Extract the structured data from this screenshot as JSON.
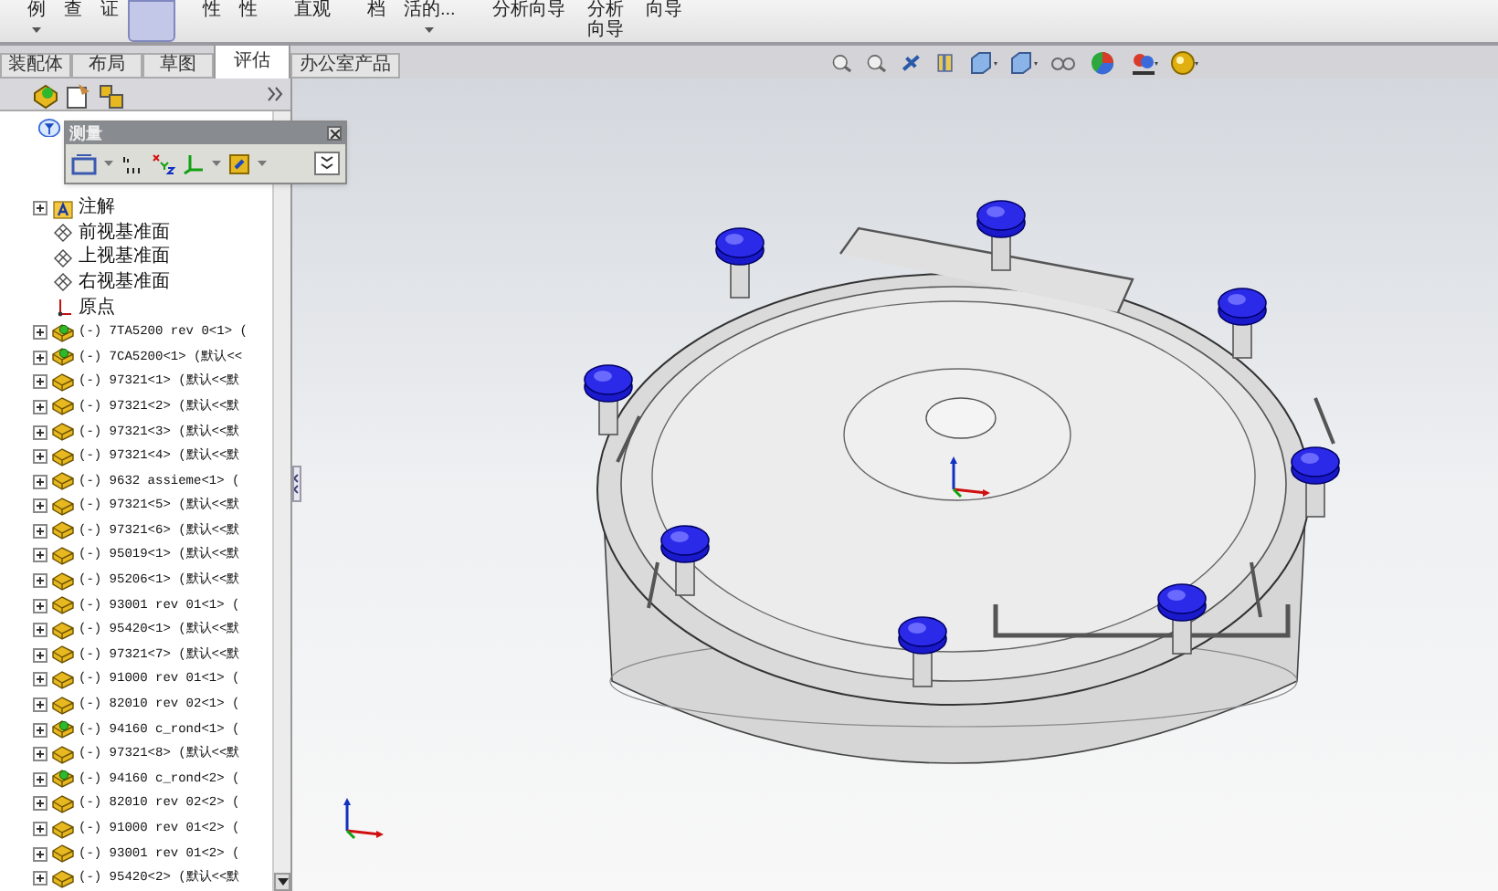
{
  "ribbon": [
    {
      "label": "例",
      "selected": false,
      "dropdown": true
    },
    {
      "label": "查",
      "selected": false,
      "dropdown": false
    },
    {
      "label": "证",
      "selected": false,
      "dropdown": false
    },
    {
      "selected": true,
      "dropdown": false
    },
    {
      "label": "性",
      "selected": false,
      "dropdown": false
    },
    {
      "label": "性",
      "selected": false,
      "dropdown": false
    },
    {
      "label": "直观",
      "selected": false,
      "dropdown": false
    },
    {
      "label": "档",
      "selected": false,
      "dropdown": false
    },
    {
      "label": "活的...",
      "selected": false,
      "dropdown": true
    },
    {
      "label": "分析向导",
      "selected": false,
      "dropdown": false
    },
    {
      "label": "分析向导",
      "selected": false,
      "dropdown": false
    },
    {
      "label": "向导",
      "selected": false,
      "dropdown": false
    }
  ],
  "tabs": [
    {
      "label": "装配体",
      "selected": false
    },
    {
      "label": "布局",
      "selected": false
    },
    {
      "label": "草图",
      "selected": false
    },
    {
      "label": "评估",
      "selected": true
    },
    {
      "label": "办公室产品",
      "selected": false
    }
  ],
  "measure": {
    "title": "测量"
  },
  "tree": {
    "features": [
      {
        "label": "注解",
        "kind": "annotation"
      },
      {
        "label": "前视基准面",
        "kind": "plane"
      },
      {
        "label": "上视基准面",
        "kind": "plane"
      },
      {
        "label": "右视基准面",
        "kind": "plane"
      },
      {
        "label": "原点",
        "kind": "origin"
      }
    ],
    "components": [
      {
        "label": "(-) 7TA5200 rev 0<1> (",
        "kind": "subassembly",
        "expanded": false
      },
      {
        "label": "(-) 7CA5200<1> (默认<<",
        "kind": "subassembly",
        "expanded": false
      },
      {
        "label": "(-) 97321<1> (默认<<默",
        "kind": "part",
        "expanded": false
      },
      {
        "label": "(-) 97321<2> (默认<<默",
        "kind": "part",
        "expanded": false
      },
      {
        "label": "(-) 97321<3> (默认<<默",
        "kind": "part",
        "expanded": false
      },
      {
        "label": "(-) 97321<4> (默认<<默",
        "kind": "part",
        "expanded": false
      },
      {
        "label": "(-) 9632 assieme<1> (",
        "kind": "part",
        "expanded": false
      },
      {
        "label": "(-) 97321<5> (默认<<默",
        "kind": "part",
        "expanded": false
      },
      {
        "label": "(-) 97321<6> (默认<<默",
        "kind": "part",
        "expanded": false
      },
      {
        "label": "(-) 95019<1> (默认<<默",
        "kind": "part",
        "expanded": false
      },
      {
        "label": "(-) 95206<1> (默认<<默",
        "kind": "part",
        "expanded": false
      },
      {
        "label": "(-) 93001 rev 01<1> (",
        "kind": "part",
        "expanded": false
      },
      {
        "label": "(-) 95420<1> (默认<<默",
        "kind": "part",
        "expanded": false
      },
      {
        "label": "(-) 97321<7> (默认<<默",
        "kind": "part",
        "expanded": false
      },
      {
        "label": "(-) 91000 rev 01<1> (",
        "kind": "part",
        "expanded": false
      },
      {
        "label": "(-) 82010 rev 02<1> (",
        "kind": "part",
        "expanded": false
      },
      {
        "label": "(-) 94160 c_rond<1> (",
        "kind": "subassembly",
        "expanded": false
      },
      {
        "label": "(-) 97321<8> (默认<<默",
        "kind": "part",
        "expanded": false
      },
      {
        "label": "(-) 94160 c_rond<2> (",
        "kind": "subassembly",
        "expanded": false
      },
      {
        "label": "(-) 82010 rev 02<2> (",
        "kind": "part",
        "expanded": false
      },
      {
        "label": "(-) 91000 rev 01<2> (",
        "kind": "part",
        "expanded": false
      },
      {
        "label": "(-) 93001 rev 01<2> (",
        "kind": "part",
        "expanded": false
      },
      {
        "label": "(-) 95420<2> (默认<<默",
        "kind": "part",
        "expanded": false
      }
    ]
  }
}
